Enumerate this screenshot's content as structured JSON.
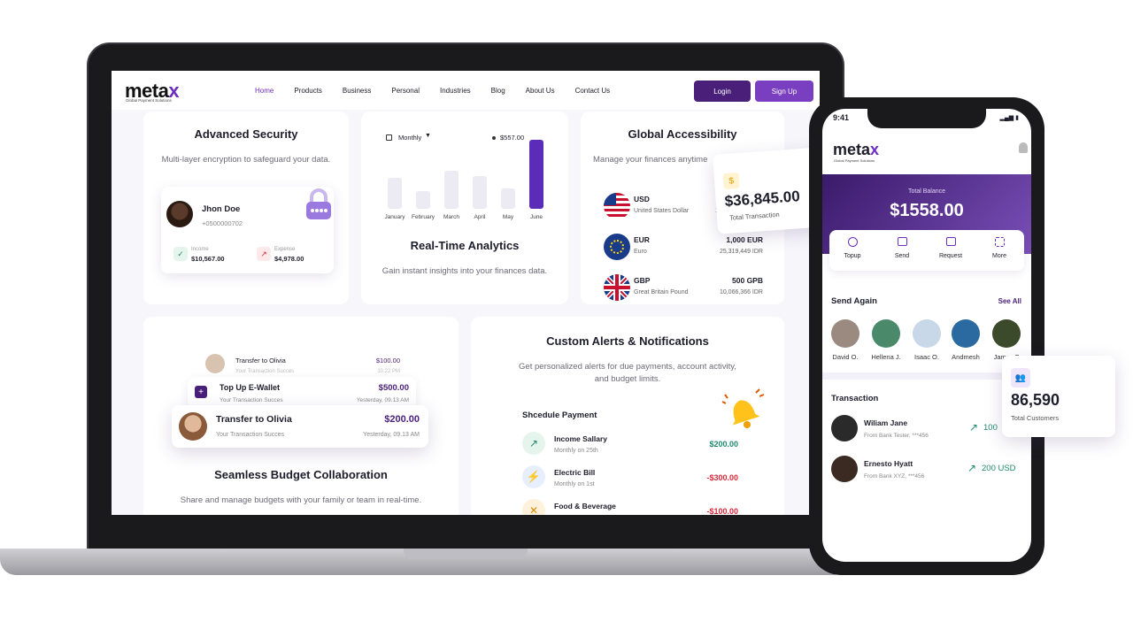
{
  "nav": {
    "logo_main": "meta",
    "logo_x": "x",
    "logo_sub": "Global Payment Solutions",
    "links": [
      "Home",
      "Products",
      "Business",
      "Personal",
      "Industries",
      "Blog",
      "About Us",
      "Contact Us"
    ],
    "login": "Login",
    "signup": "Sign Up"
  },
  "security": {
    "title": "Advanced Security",
    "desc": "Multi-layer encryption to safeguard your data.",
    "user_name": "Jhon Doe",
    "user_phone": "+0500000702",
    "income_label": "Income",
    "income_value": "$10,567.00",
    "expense_label": "Expense",
    "expense_value": "$4,978.00"
  },
  "analytics": {
    "period": "Monthly",
    "peak_value": "$557.00",
    "months": [
      "January",
      "February",
      "March",
      "April",
      "May",
      "June"
    ],
    "bar_levels": [
      0.45,
      0.25,
      0.55,
      0.48,
      0.3,
      1.0
    ],
    "title": "Real-Time Analytics",
    "desc": "Gain instant insights into your finances data."
  },
  "global": {
    "title": "Global Accessibility",
    "desc": "Manage your finances anytime",
    "currencies": [
      {
        "code": "USD",
        "name": "United States Dollar",
        "amount": "",
        "idr": "1("
      },
      {
        "code": "EUR",
        "name": "Euro",
        "amount": "1,000 EUR",
        "idr": "25,319,449 IDR"
      },
      {
        "code": "GBP",
        "name": "Great Britain Pound",
        "amount": "500 GPB",
        "idr": "10,066,366 IDR"
      }
    ]
  },
  "total_tx": {
    "value": "$36,845.00",
    "label": "Total Transaction"
  },
  "budget": {
    "title": "Seamless Budget Collaboration",
    "desc": "Share and manage budgets with your family or team in real-time.",
    "items": [
      {
        "title": "Transfer to Olivia",
        "sub": "Your Transaction Succes",
        "amount": "$100.00",
        "time": "10.22 PM"
      },
      {
        "title": "Top Up E-Wallet",
        "sub": "Your Transaction Succes",
        "amount": "$500.00",
        "time": "Yesterday, 09.13 AM"
      },
      {
        "title": "Transfer to Olivia",
        "sub": "Your Transaction Succes",
        "amount": "$200.00",
        "time": "Yesterday, 09.13 AM"
      }
    ]
  },
  "alerts": {
    "title": "Custom Alerts & Notifications",
    "desc": "Get personalized alerts for due payments, account activity, and budget limits.",
    "schedule_title": "Shcedule Payment",
    "payments": [
      {
        "title": "Income Sallary",
        "sub": "Monthly on 25th",
        "amount": "$200.00"
      },
      {
        "title": "Electric Bill",
        "sub": "Monthly on 1st",
        "amount": "-$300.00"
      },
      {
        "title": "Food & Beverage",
        "sub": "",
        "amount": "-$100.00"
      }
    ]
  },
  "phone": {
    "time": "9:41",
    "balance_label": "Total Balance",
    "balance_value": "$1558.00",
    "actions": [
      "Topup",
      "Send",
      "Request",
      "More"
    ],
    "send_again": "Send Again",
    "see_all": "See All",
    "contacts": [
      "David O.",
      "Hellena J.",
      "Isaac O.",
      "Andmesh",
      "James F"
    ],
    "transaction_title": "Transaction",
    "transactions": [
      {
        "name": "Wiliam Jane",
        "sub": "From Bank Tester, ***456",
        "amount": "100"
      },
      {
        "name": "Ernesto Hyatt",
        "sub": "From Bank XYZ, ***456",
        "amount": "200 USD"
      }
    ]
  },
  "customers": {
    "value": "86,590",
    "label": "Total Customers"
  },
  "colors": {
    "brand": "#6b2fbf",
    "brand_dark": "#4a1f7a",
    "positive": "#1f8a6a",
    "negative": "#d8283a"
  }
}
